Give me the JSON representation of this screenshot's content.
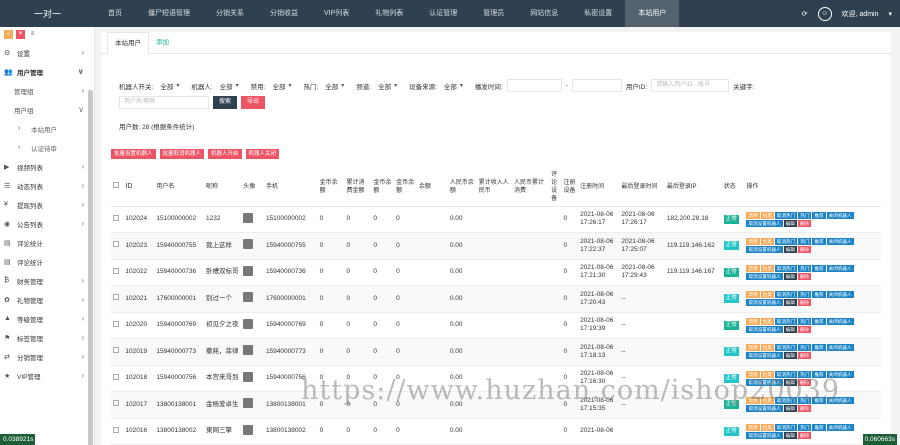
{
  "brand": "一对一",
  "topnav": [
    "首页",
    "僵尸短语管理",
    "分销关系",
    "分销收益",
    "VIP列表",
    "礼物列表",
    "认证管理",
    "管理员",
    "网站信息",
    "私密设置",
    "本站用户"
  ],
  "topright": {
    "refresh_icon": "refresh-icon",
    "user": "欢迎, admin"
  },
  "sidebar": [
    {
      "label": "设置",
      "icon": "gear-icon",
      "arrow": "›",
      "cls": ""
    },
    {
      "label": "用户管理",
      "icon": "users-icon",
      "arrow": "∨",
      "cls": "open"
    },
    {
      "label": "管理组",
      "icon": "",
      "arrow": "›",
      "cls": "sub"
    },
    {
      "label": "用户组",
      "icon": "",
      "arrow": "∨",
      "cls": "sub"
    },
    {
      "label": "本站用户",
      "icon": "",
      "arrow": "",
      "cls": "sub2"
    },
    {
      "label": "认证待审",
      "icon": "",
      "arrow": "",
      "cls": "sub2"
    },
    {
      "label": "视频列表",
      "icon": "video-icon",
      "arrow": "›",
      "cls": ""
    },
    {
      "label": "动态列表",
      "icon": "list-icon",
      "arrow": "›",
      "cls": ""
    },
    {
      "label": "提现列表",
      "icon": "money-icon",
      "arrow": "›",
      "cls": ""
    },
    {
      "label": "公告列表",
      "icon": "globe-icon",
      "arrow": "›",
      "cls": ""
    },
    {
      "label": "评论统计",
      "icon": "chart-icon",
      "arrow": "",
      "cls": ""
    },
    {
      "label": "评论统计",
      "icon": "chart-icon",
      "arrow": "",
      "cls": ""
    },
    {
      "label": "财务管理",
      "icon": "finance-icon",
      "arrow": "›",
      "cls": ""
    },
    {
      "label": "礼物管理",
      "icon": "gift-icon",
      "arrow": "›",
      "cls": ""
    },
    {
      "label": "等级管理",
      "icon": "level-icon",
      "arrow": "›",
      "cls": ""
    },
    {
      "label": "标签管理",
      "icon": "tag-icon",
      "arrow": "›",
      "cls": ""
    },
    {
      "label": "分销管理",
      "icon": "share-icon",
      "arrow": "›",
      "cls": ""
    },
    {
      "label": "VIP管理",
      "icon": "star-icon",
      "arrow": "›",
      "cls": ""
    }
  ],
  "tabs": [
    "本站用户",
    "添加"
  ],
  "filters": {
    "row1": [
      {
        "label": "机器人开关:",
        "value": "全部"
      },
      {
        "label": "机器人:",
        "value": "全部"
      },
      {
        "label": "禁用:",
        "value": "全部"
      },
      {
        "label": "热门:",
        "value": "全部"
      },
      {
        "label": "频道:",
        "value": "全部"
      },
      {
        "label": "设备来源:",
        "value": "全部"
      }
    ],
    "time_label": "播发时间:",
    "time_sep": "-",
    "uid_label": "用户ID:",
    "uid_placeholder": "请输入用户ID、账号",
    "kw_label": "关键字:",
    "kw_placeholder": "用户名/昵称",
    "search": "搜索",
    "export": "导出"
  },
  "info": "用户数: 28 (根据条件统计)",
  "actions": [
    "批量设置机器人",
    "批量取消机器人",
    "机器人开启",
    "机器人关闭"
  ],
  "columns": [
    "ID",
    "用户名",
    "昵称",
    "头像",
    "手机",
    "金币余额",
    "累计消费金额",
    "金币余额",
    "金币余额",
    "余额",
    "人民币余额",
    "累计收入人民币",
    "人民币累计消费",
    "评论设备",
    "注册设备",
    "注册时间",
    "最后登录时间",
    "最后登录IP",
    "状态",
    "操作"
  ],
  "rows": [
    {
      "id": "102024",
      "user": "15100000002",
      "nick": "1232",
      "phone": "15100000002",
      "c1": "0",
      "c2": "0",
      "c3": "0",
      "c4": "0",
      "c5": "0.00",
      "reg": "0",
      "regtime": "2021-08-06 17:26:17",
      "last": "2021-08-06 17:26:17",
      "ip": "182.200.28.18",
      "status": "正常",
      "sg": "g"
    },
    {
      "id": "102023",
      "user": "15940000755",
      "nick": "我上这样",
      "phone": "15940000755",
      "c1": "0",
      "c2": "0",
      "c3": "0",
      "c4": "0",
      "c5": "0.00",
      "reg": "0",
      "regtime": "2021-08-06 17:22:37",
      "last": "2021-08-06 17:25:07",
      "ip": "119.119.146.162",
      "status": "正常",
      "sg": "b"
    },
    {
      "id": "102022",
      "user": "15940000736",
      "nick": "卧槽双标哥",
      "phone": "15940000736",
      "c1": "0",
      "c2": "0",
      "c3": "0",
      "c4": "0",
      "c5": "0.00",
      "reg": "0",
      "regtime": "2021-08-06 17:21:30",
      "last": "2021-08-06 17:29:43",
      "ip": "119.119.146.167",
      "status": "正常",
      "sg": "g"
    },
    {
      "id": "102021",
      "user": "17600000001",
      "nick": "别过一个",
      "phone": "17600000001",
      "c1": "0",
      "c2": "0",
      "c3": "0",
      "c4": "0",
      "c5": "0.00",
      "reg": "0",
      "regtime": "2021-08-06 17:20:43",
      "last": "--",
      "ip": "",
      "status": "正常",
      "sg": "b"
    },
    {
      "id": "102020",
      "user": "15940000769",
      "nick": "初见夕之夜",
      "phone": "15940000769",
      "c1": "0",
      "c2": "0",
      "c3": "0",
      "c4": "0",
      "c5": "0.00",
      "reg": "0",
      "regtime": "2021-08-06 17:19:39",
      "last": "--",
      "ip": "",
      "status": "正常",
      "sg": "g"
    },
    {
      "id": "102019",
      "user": "15940000773",
      "nick": "撒耗，菲律",
      "phone": "15940000773",
      "c1": "0",
      "c2": "0",
      "c3": "0",
      "c4": "0",
      "c5": "0.00",
      "reg": "0",
      "regtime": "2021-08-06 17:18:13",
      "last": "--",
      "ip": "",
      "status": "正常",
      "sg": "b"
    },
    {
      "id": "102018",
      "user": "15940000756",
      "nick": "本宫来哥到",
      "phone": "15940000756",
      "c1": "0",
      "c2": "0",
      "c3": "0",
      "c4": "0",
      "c5": "0.00",
      "reg": "0",
      "regtime": "2021-08-06 17:16:30",
      "last": "--",
      "ip": "",
      "status": "正常",
      "sg": "b"
    },
    {
      "id": "102017",
      "user": "13800138001",
      "nick": "金杨爱卓生",
      "phone": "13800138001",
      "c1": "0",
      "c2": "0",
      "c3": "0",
      "c4": "0",
      "c5": "0.00",
      "reg": "0",
      "regtime": "2021-08-06 17:15:35",
      "last": "--",
      "ip": "",
      "status": "正常",
      "sg": "g"
    },
    {
      "id": "102016",
      "user": "13800138002",
      "nick": "東网三擎",
      "phone": "13800138002",
      "c1": "0",
      "c2": "0",
      "c3": "0",
      "c4": "0",
      "c5": "0.00",
      "reg": "0",
      "regtime": "2021-08-06",
      "last": "",
      "ip": "",
      "status": "正常",
      "sg": "b"
    }
  ],
  "ops": [
    {
      "t": "禁用",
      "c": "o"
    },
    {
      "t": "拉黑",
      "c": "o"
    },
    {
      "t": "取消热门",
      "c": "bl"
    },
    {
      "t": "热门",
      "c": "bl"
    },
    {
      "t": "推荐",
      "c": "bl"
    },
    {
      "t": "关闭机器人",
      "c": "bl"
    },
    {
      "t": "取消设置机器人",
      "c": "bl"
    },
    {
      "t": "编辑",
      "c": "dk"
    },
    {
      "t": "删除",
      "c": "rd"
    }
  ],
  "watermark": "https://www.huzhan.com/ishop20039",
  "fps_left": "0.038921s",
  "fps_right": "0.060663s"
}
